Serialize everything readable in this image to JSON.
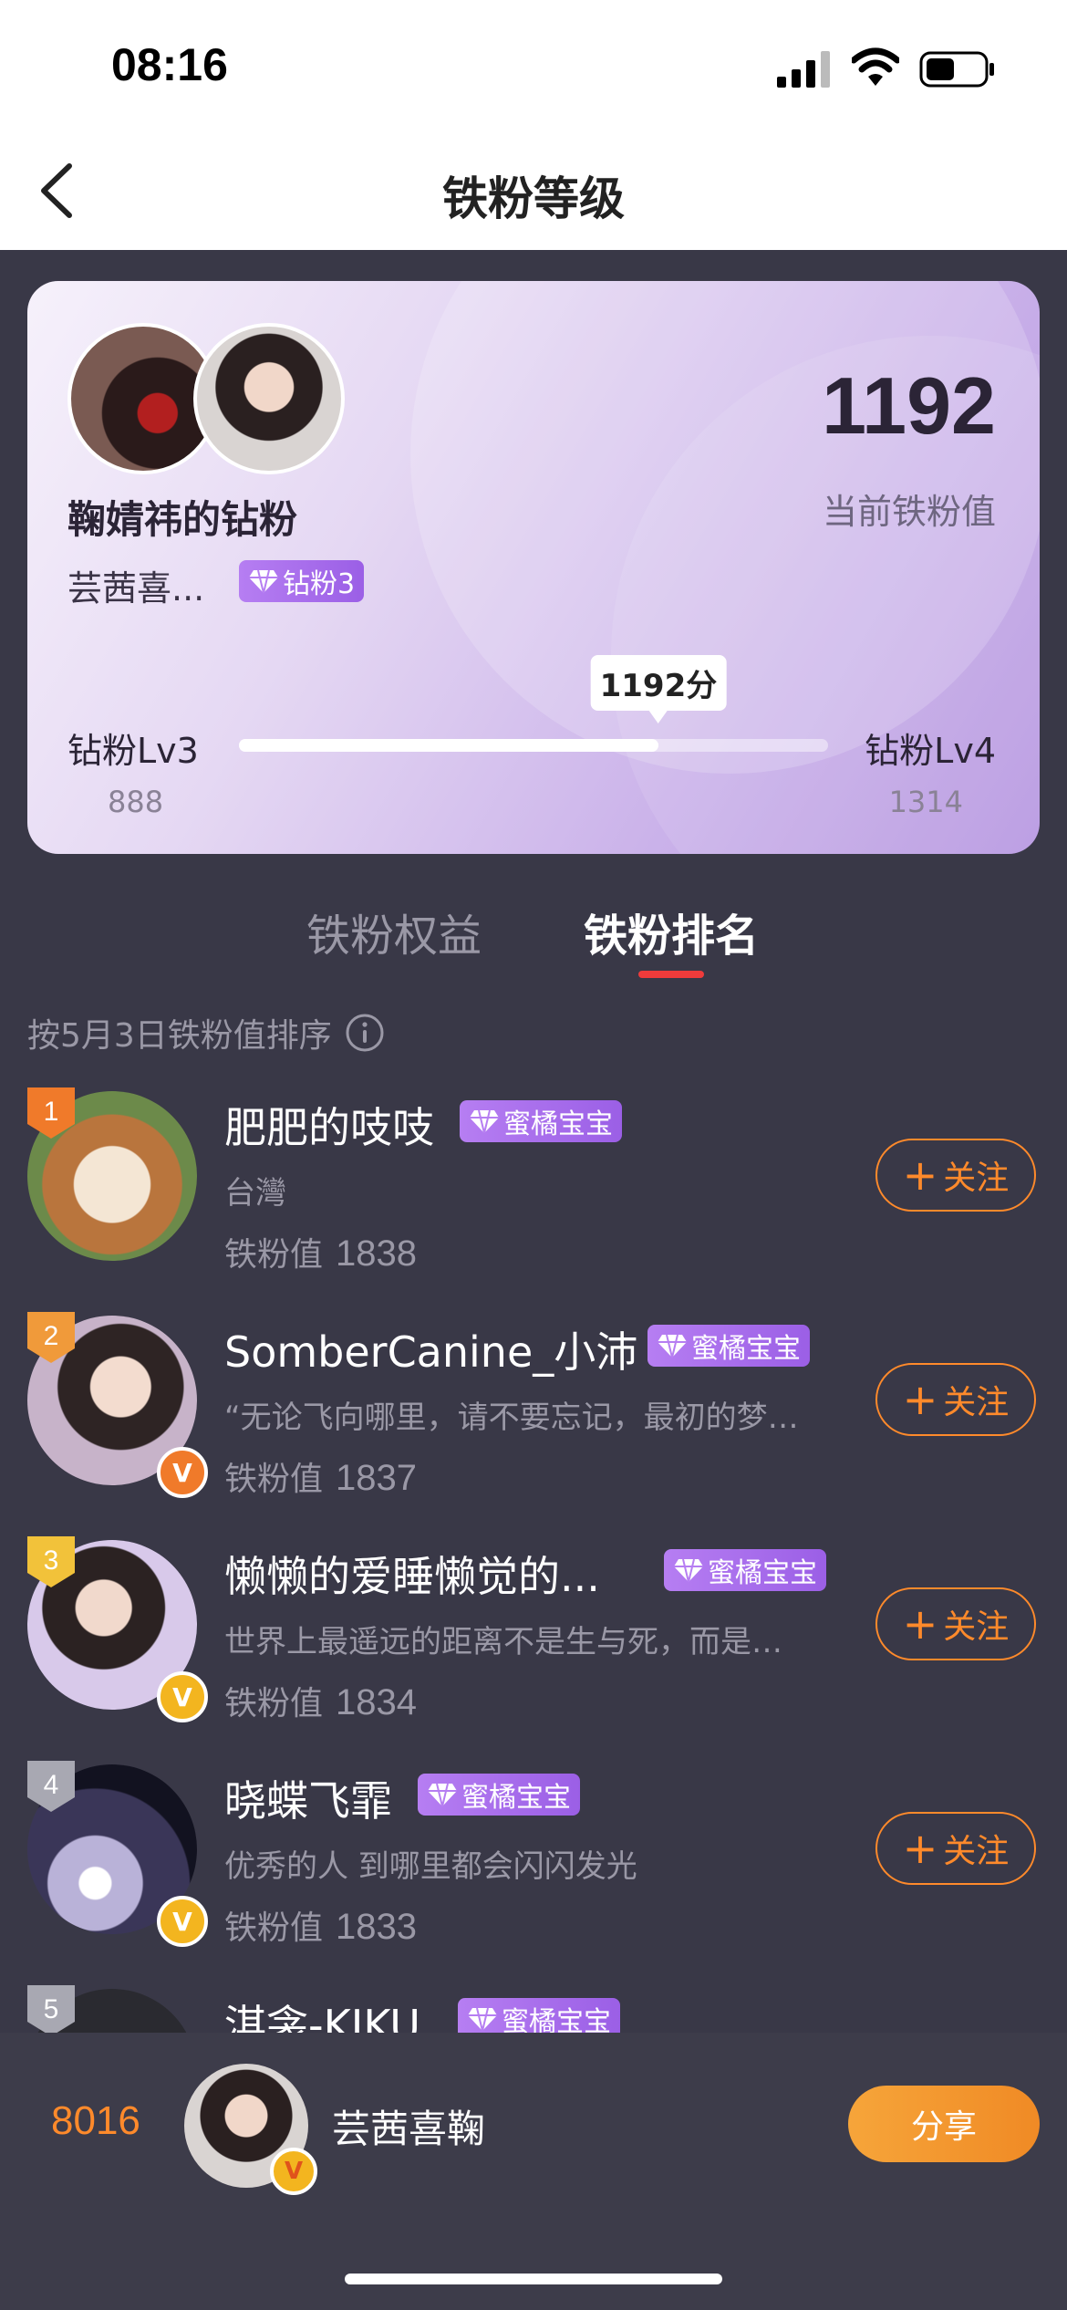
{
  "status_bar": {
    "time": "08:16"
  },
  "nav": {
    "title": "铁粉等级",
    "back_icon": "chevron-left-icon"
  },
  "card": {
    "name": "鞠婧祎的钻粉",
    "username": "芸茜喜...",
    "badge": "钻粉3",
    "score": "1192",
    "score_label": "当前铁粉值",
    "progress_tip": "1192分",
    "level_left": "钻粉Lv3",
    "level_right": "钻粉Lv4",
    "min": "888",
    "max": "1314",
    "progress_fraction": 0.712
  },
  "tabs": [
    {
      "label": "铁粉权益",
      "active": false
    },
    {
      "label": "铁粉排名",
      "active": true
    }
  ],
  "sort_note": "按5月3日铁粉值排序",
  "ranking": {
    "score_label": "铁粉值",
    "follow_label": "关注",
    "items": [
      {
        "rank": "1",
        "name": "肥肥的吱吱",
        "badge": "蜜橘宝宝",
        "desc": "台灣",
        "score": "1838",
        "rank_color": "#f07a2a",
        "verified": ""
      },
      {
        "rank": "2",
        "name": "SomberCanine_小沛",
        "badge": "蜜橘宝宝",
        "desc": "“无论飞向哪里，请不要忘记，最初的梦…",
        "score": "1837",
        "rank_color": "#f09a3a",
        "verified": "orange"
      },
      {
        "rank": "3",
        "name": "懒懒的爱睡懒觉的...",
        "badge": "蜜橘宝宝",
        "desc": "世界上最遥远的距离不是生与死，而是…",
        "score": "1834",
        "rank_color": "#f2c23a",
        "verified": "gold"
      },
      {
        "rank": "4",
        "name": "晓蝶飞霏",
        "badge": "蜜橘宝宝",
        "desc": "优秀的人 到哪里都会闪闪发光",
        "score": "1833",
        "rank_color": "#a8a8b2",
        "verified": "gold"
      },
      {
        "rank": "5",
        "name": "淇衾-KIKU",
        "badge": "蜜橘宝宝",
        "desc": "",
        "score": "",
        "rank_color": "#a8a8b2",
        "verified": ""
      }
    ]
  },
  "bottom": {
    "my_rank": "8016",
    "my_name": "芸茜喜鞠",
    "share_label": "分享"
  }
}
